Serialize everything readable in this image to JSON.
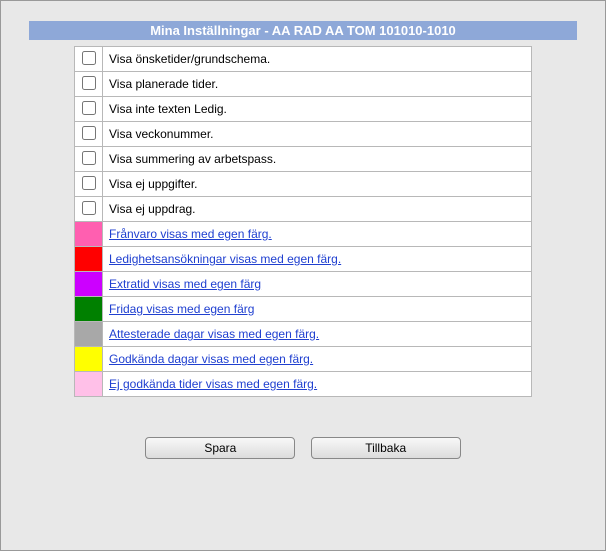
{
  "header": {
    "title": "Mina Inställningar - AA RAD AA TOM 101010-1010"
  },
  "checkbox_rows": [
    {
      "label": "Visa önsketider/grundschema."
    },
    {
      "label": "Visa planerade tider."
    },
    {
      "label": "Visa inte texten Ledig."
    },
    {
      "label": "Visa veckonummer."
    },
    {
      "label": "Visa summering av arbetspass."
    },
    {
      "label": "Visa ej uppgifter."
    },
    {
      "label": "Visa ej uppdrag."
    }
  ],
  "color_rows": [
    {
      "color": "#ff5fb0",
      "label": " Frånvaro visas med egen färg."
    },
    {
      "color": "#ff0000",
      "label": " Ledighetsansökningar visas med egen färg."
    },
    {
      "color": "#cc00ff",
      "label": " Extratid visas med egen färg"
    },
    {
      "color": "#008000",
      "label": " Fridag visas med egen färg"
    },
    {
      "color": "#a8a8a8",
      "label": " Attesterade dagar visas med egen färg."
    },
    {
      "color": "#ffff00",
      "label": " Godkända dagar visas med egen färg."
    },
    {
      "color": "#ffc0e8",
      "label": " Ej godkända tider visas med egen färg."
    }
  ],
  "buttons": {
    "save": "Spara",
    "back": "Tillbaka"
  }
}
